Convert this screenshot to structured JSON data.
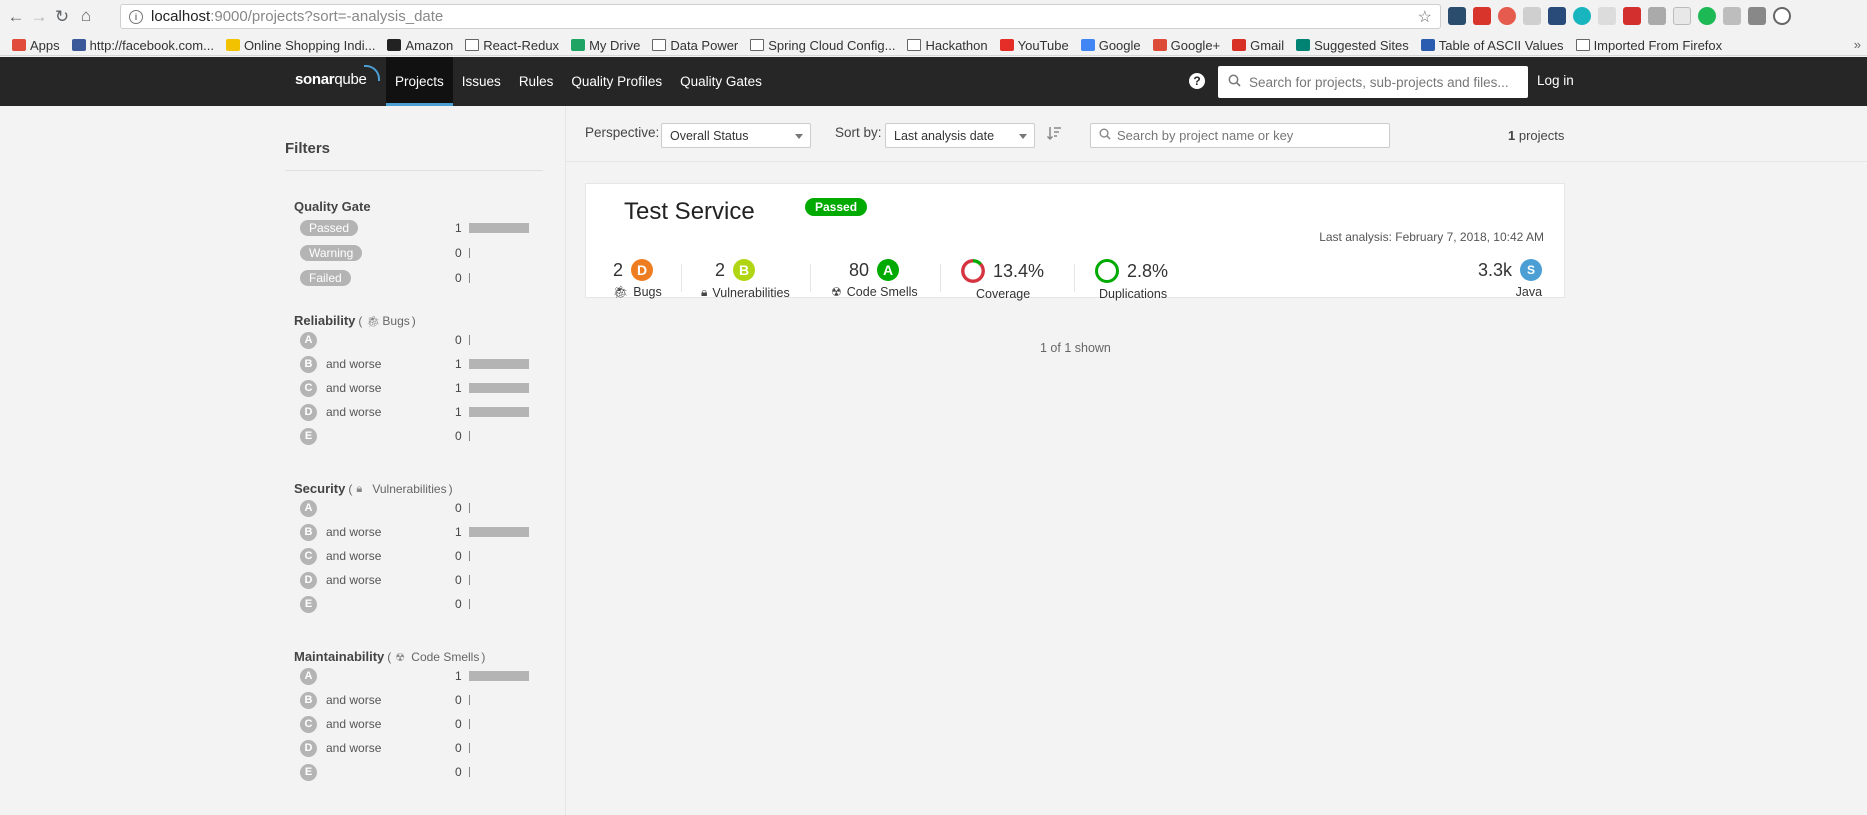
{
  "browser": {
    "url_host": "localhost",
    "url_path": ":9000/projects?sort=-analysis_date",
    "bookmarks": [
      {
        "label": "Apps",
        "icon": "apps-grid-icon"
      },
      {
        "label": "http://facebook.com...",
        "icon": "facebook-icon"
      },
      {
        "label": "Online Shopping Indi...",
        "icon": "shopping-icon"
      },
      {
        "label": "Amazon",
        "icon": "amazon-icon"
      },
      {
        "label": "React-Redux",
        "icon": "folder-icon"
      },
      {
        "label": "My Drive",
        "icon": "drive-icon"
      },
      {
        "label": "Data Power",
        "icon": "folder-icon"
      },
      {
        "label": "Spring Cloud Config...",
        "icon": "folder-icon"
      },
      {
        "label": "Hackathon",
        "icon": "folder-icon"
      },
      {
        "label": "YouTube",
        "icon": "youtube-icon"
      },
      {
        "label": "Google",
        "icon": "google-icon"
      },
      {
        "label": "Google+",
        "icon": "google-plus-icon"
      },
      {
        "label": "Gmail",
        "icon": "gmail-icon"
      },
      {
        "label": "Suggested Sites",
        "icon": "bing-icon"
      },
      {
        "label": "Table of ASCII Values",
        "icon": "ascii-icon"
      },
      {
        "label": "Imported From Firefox",
        "icon": "folder-icon"
      }
    ],
    "more": "»"
  },
  "nav": {
    "logo_a": "sonar",
    "logo_b": "qube",
    "items": [
      "Projects",
      "Issues",
      "Rules",
      "Quality Profiles",
      "Quality Gates"
    ],
    "help": "?",
    "search_placeholder": "Search for projects, sub-projects and files...",
    "login": "Log in"
  },
  "filters": {
    "title": "Filters",
    "quality_gate": {
      "title": "Quality Gate",
      "rows": [
        {
          "label": "Passed",
          "count": "1",
          "fraction": 1
        },
        {
          "label": "Warning",
          "count": "0",
          "fraction": 0
        },
        {
          "label": "Failed",
          "count": "0",
          "fraction": 0
        }
      ]
    },
    "and_worse": "and worse",
    "reliability": {
      "title": "Reliability",
      "open": "(",
      "sub": "Bugs",
      "close": ")",
      "rows": [
        {
          "grade": "A",
          "worse": false,
          "count": "0",
          "fraction": 0
        },
        {
          "grade": "B",
          "worse": true,
          "count": "1",
          "fraction": 1
        },
        {
          "grade": "C",
          "worse": true,
          "count": "1",
          "fraction": 1
        },
        {
          "grade": "D",
          "worse": true,
          "count": "1",
          "fraction": 1
        },
        {
          "grade": "E",
          "worse": false,
          "count": "0",
          "fraction": 0
        }
      ]
    },
    "security": {
      "title": "Security",
      "open": "(",
      "sub": "Vulnerabilities",
      "close": ")",
      "rows": [
        {
          "grade": "A",
          "worse": false,
          "count": "0",
          "fraction": 0
        },
        {
          "grade": "B",
          "worse": true,
          "count": "1",
          "fraction": 1
        },
        {
          "grade": "C",
          "worse": true,
          "count": "0",
          "fraction": 0
        },
        {
          "grade": "D",
          "worse": true,
          "count": "0",
          "fraction": 0
        },
        {
          "grade": "E",
          "worse": false,
          "count": "0",
          "fraction": 0
        }
      ]
    },
    "maintainability": {
      "title": "Maintainability",
      "open": "(",
      "sub": "Code Smells",
      "close": ")",
      "rows": [
        {
          "grade": "A",
          "worse": false,
          "count": "1",
          "fraction": 1
        },
        {
          "grade": "B",
          "worse": true,
          "count": "0",
          "fraction": 0
        },
        {
          "grade": "C",
          "worse": true,
          "count": "0",
          "fraction": 0
        },
        {
          "grade": "D",
          "worse": true,
          "count": "0",
          "fraction": 0
        },
        {
          "grade": "E",
          "worse": false,
          "count": "0",
          "fraction": 0
        }
      ]
    }
  },
  "toolbar": {
    "perspective_label": "Perspective:",
    "perspective_value": "Overall Status",
    "sort_label": "Sort by:",
    "sort_value": "Last analysis date",
    "search_placeholder": "Search by project name or key",
    "count_num": "1",
    "count_text": " projects"
  },
  "project": {
    "name": "Test Service",
    "gate": "Passed",
    "last_analysis": "Last analysis: February 7, 2018, 10:42 AM",
    "bugs": {
      "value": "2",
      "rating": "D",
      "label": "Bugs",
      "color": "#ed7d20"
    },
    "vulnerabilities": {
      "value": "2",
      "rating": "B",
      "label": "Vulnerabilities",
      "color": "#b0d513"
    },
    "code_smells": {
      "value": "80",
      "rating": "A",
      "label": "Code Smells",
      "color": "#00aa00"
    },
    "coverage": {
      "value": "13.4%",
      "label": "Coverage",
      "percent": 13.4
    },
    "duplications": {
      "value": "2.8%",
      "label": "Duplications"
    },
    "size": {
      "value": "3.3k",
      "badge": "S",
      "label": "Java"
    }
  },
  "shown": "1 of 1 shown"
}
